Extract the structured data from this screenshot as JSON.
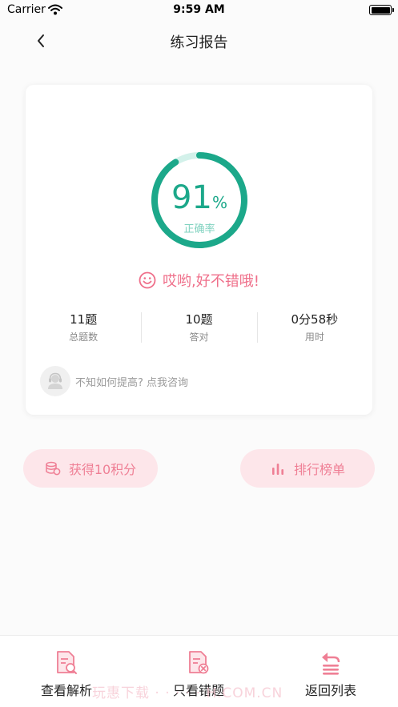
{
  "status_bar": {
    "carrier": "Carrier",
    "time": "9:59 AM"
  },
  "nav": {
    "title": "练习报告"
  },
  "result": {
    "accuracy_number": "91",
    "accuracy_unit": "%",
    "accuracy_fraction": 0.91,
    "accuracy_label": "正确率",
    "praise": "哎哟,好不错哦!"
  },
  "stats": [
    {
      "value": "11题",
      "label": "总题数"
    },
    {
      "value": "10题",
      "label": "答对"
    },
    {
      "value": "0分58秒",
      "label": "用时"
    }
  ],
  "consult": {
    "text": "不知如何提高? 点我咨询"
  },
  "actions": {
    "points_label": "获得10积分",
    "rank_label": "排行榜单"
  },
  "tabs": {
    "analysis": "查看解析",
    "wrong_only": "只看错题",
    "return_list": "返回列表"
  },
  "watermark": "玩惠下载 · · · · · H.COM.CN",
  "colors": {
    "accent_green": "#1ca88a",
    "accent_pink": "#ef6f8a",
    "pill_bg": "#fde6ea"
  },
  "icons": {
    "back": "chevron-left-icon",
    "praise": "smile-icon",
    "points": "coins-icon",
    "rank": "bar-chart-icon",
    "analysis": "document-search-icon",
    "wrong": "document-x-icon",
    "return": "return-list-icon"
  }
}
